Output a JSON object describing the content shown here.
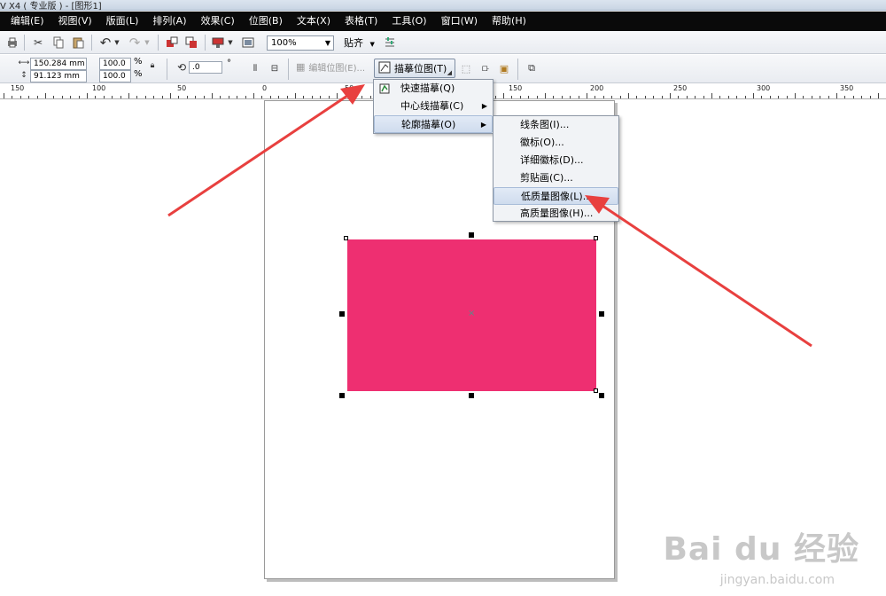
{
  "title": "V X4 ( 专业版 ) - [图形1]",
  "menubar": [
    "编辑(E)",
    "视图(V)",
    "版面(L)",
    "排列(A)",
    "效果(C)",
    "位图(B)",
    "文本(X)",
    "表格(T)",
    "工具(O)",
    "窗口(W)",
    "帮助(H)"
  ],
  "toolbar": {
    "zoom": "100%",
    "snap": "贴齐"
  },
  "propbar": {
    "width": "150.284 mm",
    "height": "91.123 mm",
    "scale_x": "100.0",
    "scale_y": "100.0",
    "percent": "%",
    "rotation": ".0",
    "degree": "°",
    "edit_bitmap": "编辑位图(E)...",
    "trace_bitmap": "描摹位图(T)"
  },
  "ruler": {
    "labels": [
      "150",
      "100",
      "50",
      "0",
      "50",
      "100",
      "150",
      "200",
      "250",
      "300",
      "350"
    ]
  },
  "menu1": {
    "items": [
      {
        "label": "快速描摹(Q)",
        "icon": "trace-icon",
        "has_sub": false
      },
      {
        "label": "中心线描摹(C)",
        "has_sub": true
      },
      {
        "label": "轮廓描摹(O)",
        "has_sub": true
      }
    ]
  },
  "menu2": {
    "items": [
      {
        "label": "线条图(I)..."
      },
      {
        "label": "徽标(O)..."
      },
      {
        "label": "详细徽标(D)..."
      },
      {
        "label": "剪贴画(C)..."
      },
      {
        "label": "低质量图像(L)..."
      },
      {
        "label": "高质量图像(H)..."
      }
    ]
  },
  "colors": {
    "rect_fill": "#ee2f71",
    "arrow": "#e8403f",
    "menubar": "#0a0a0a"
  },
  "watermark": {
    "brand": "Bai du 经验",
    "url": "jingyan.baidu.com"
  }
}
